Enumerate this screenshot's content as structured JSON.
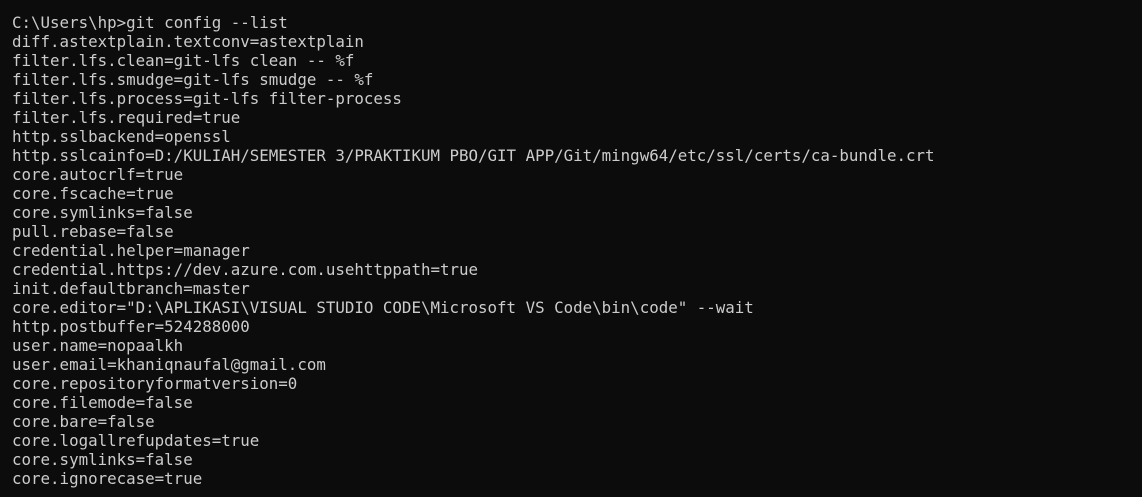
{
  "terminal": {
    "prompt": "C:\\Users\\hp>",
    "command": "git config --list",
    "output": [
      "diff.astextplain.textconv=astextplain",
      "filter.lfs.clean=git-lfs clean -- %f",
      "filter.lfs.smudge=git-lfs smudge -- %f",
      "filter.lfs.process=git-lfs filter-process",
      "filter.lfs.required=true",
      "http.sslbackend=openssl",
      "http.sslcainfo=D:/KULIAH/SEMESTER 3/PRAKTIKUM PBO/GIT APP/Git/mingw64/etc/ssl/certs/ca-bundle.crt",
      "core.autocrlf=true",
      "core.fscache=true",
      "core.symlinks=false",
      "pull.rebase=false",
      "credential.helper=manager",
      "credential.https://dev.azure.com.usehttppath=true",
      "init.defaultbranch=master",
      "core.editor=\"D:\\APLIKASI\\VISUAL STUDIO CODE\\Microsoft VS Code\\bin\\code\" --wait",
      "http.postbuffer=524288000",
      "user.name=nopaalkh",
      "user.email=khaniqnaufal@gmail.com",
      "core.repositoryformatversion=0",
      "core.filemode=false",
      "core.bare=false",
      "core.logallrefupdates=true",
      "core.symlinks=false",
      "core.ignorecase=true"
    ]
  }
}
